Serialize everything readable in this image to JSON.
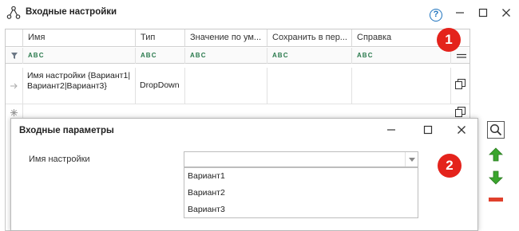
{
  "window": {
    "title": "Входные настройки"
  },
  "grid": {
    "headers": [
      "Имя",
      "Тип",
      "Значение по ум...",
      "Сохранить в пер...",
      "Справка"
    ],
    "rows": [
      {
        "name": "Имя настройки {Вариант1|Вариант2|Вариант3}",
        "type": "DropDown",
        "value": "",
        "save": "",
        "help": ""
      }
    ]
  },
  "badges": [
    "1",
    "2"
  ],
  "dialog": {
    "title": "Входные параметры",
    "field_label": "Имя настройки",
    "options": [
      "Вариант1",
      "Вариант2",
      "Вариант3"
    ]
  },
  "colors": {
    "badge": "#e4231c",
    "up_arrow": "#3aa52d",
    "remove": "#e0402c",
    "help": "#1e73be"
  }
}
